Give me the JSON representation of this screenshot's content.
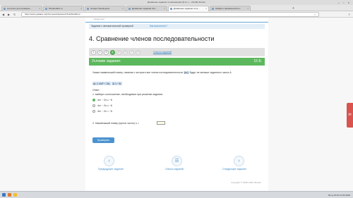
{
  "window": {
    "title": "Домашнее задание по математике (8 кл.) — Mozilla Firefox",
    "controls": "– ▫ ×"
  },
  "tabs": [
    {
      "label": "контроль для проверки...",
      "close": "×"
    },
    {
      "label": "Plusandtard.ru",
      "close": "×"
    },
    {
      "label": "Google Переводчик",
      "close": "×"
    },
    {
      "label": "Домашнее задание Кол...",
      "close": "×"
    },
    {
      "label": "Домашнее задание по м...",
      "close": "×"
    },
    {
      "label": "Найдите наименьший но...",
      "close": "×"
    }
  ],
  "nav": {
    "back": "◀",
    "forward": "▶",
    "reload": "↻",
    "url": "https://www.yaklass.ru/p/homework/testwork/TestWorkRun/...",
    "star": "☆",
    "menu": "≡",
    "newtab": "+"
  },
  "page": {
    "top_strip": "< вернуться",
    "breadcrumb": {
      "text": "Задание с автоматической проверкой",
      "link": "Как выполнять?"
    },
    "title": "4. Сравнение членов последовательности",
    "task_pills": [
      "1",
      "2",
      "3",
      "4",
      "5",
      "6",
      "7",
      "8"
    ],
    "all_tasks": "Список заданий",
    "condition": {
      "title": "Условие задания:",
      "score": "15 Б."
    },
    "task_text": {
      "part1": "Укажи наименьший номер, начиная с которого все члены последовательности",
      "seq": "(aₙ)",
      "part2": "будут не меньше заданного числа A."
    },
    "expression": {
      "lhs": "aₙ = 4n² − 2n,",
      "rhs": "A = −6."
    },
    "answer_label": "Ответ:",
    "step1": "1. выбери соотношение, необходимое при решении задания:",
    "options": [
      {
        "text": "4n² − 2n ≥ −6",
        "selected": true
      },
      {
        "text": "4n² − 2n ≤ −6",
        "selected": false
      },
      {
        "text": "4n² − 2n > −6",
        "selected": false
      }
    ],
    "step2": "2. Наименьший номер (целое число) n =",
    "step2_end": ".",
    "check_button": "Проверить",
    "bottom_nav": {
      "prev_icon": "‹",
      "prev": "Предыдущее задание",
      "list_icon": "☰",
      "list": "Список заданий",
      "next_icon": "›",
      "next": "Следующее задание"
    },
    "copyright": "Copyright © 2008–2020 ЯКласс",
    "feedback_icon": "✉"
  },
  "taskbar": {
    "tray": "RU  ▴  16:43  12.03.2020"
  },
  "colors": {
    "accent_green": "#5cb85c",
    "link_blue": "#3c88c6",
    "button_blue": "#4b93cf",
    "feedback_red": "#d9534f"
  }
}
